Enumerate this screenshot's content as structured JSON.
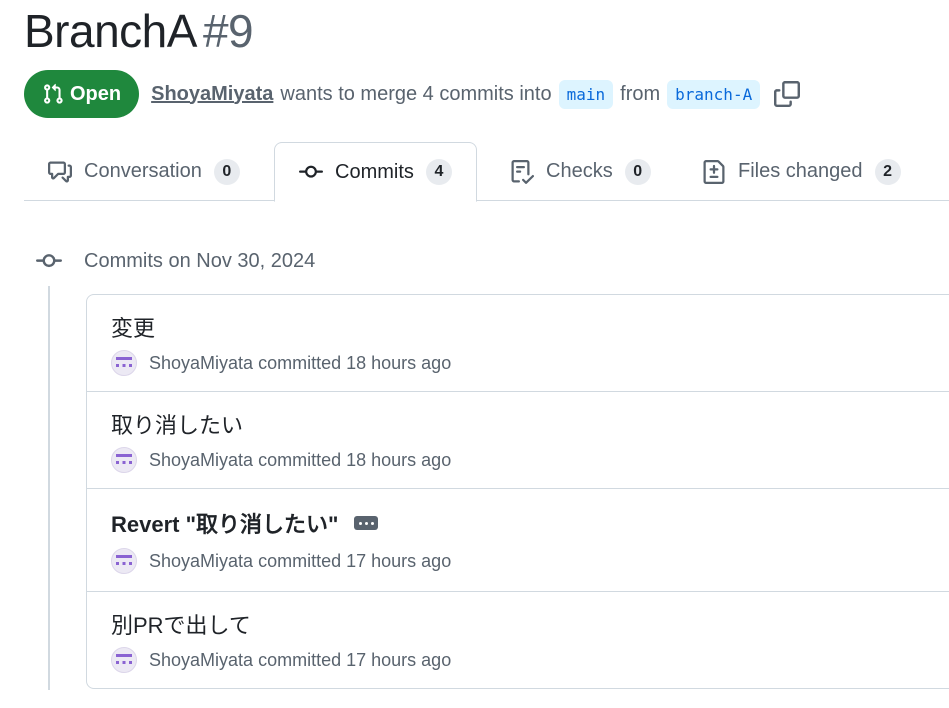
{
  "pr": {
    "title": "BranchA",
    "number": "#9",
    "state": "Open",
    "author": "ShoyaMiyata",
    "merge_text": "wants to merge 4 commits into",
    "base_branch": "main",
    "from_text": "from",
    "head_branch": "branch-A"
  },
  "tabs": [
    {
      "label": "Conversation",
      "count": "0",
      "icon": "comment-discussion-icon"
    },
    {
      "label": "Commits",
      "count": "4",
      "icon": "git-commit-icon"
    },
    {
      "label": "Checks",
      "count": "0",
      "icon": "checklist-icon"
    },
    {
      "label": "Files changed",
      "count": "2",
      "icon": "file-diff-icon"
    }
  ],
  "timeline": {
    "date_label": "Commits on Nov 30, 2024",
    "commits": [
      {
        "message": "変更",
        "author": "ShoyaMiyata",
        "action": "committed",
        "time": "18 hours ago"
      },
      {
        "message": "取り消したい",
        "author": "ShoyaMiyata",
        "action": "committed",
        "time": "18 hours ago"
      },
      {
        "message": "Revert \"取り消したい\"",
        "author": "ShoyaMiyata",
        "action": "committed",
        "time": "17 hours ago"
      },
      {
        "message": "別PRで出して",
        "author": "ShoyaMiyata",
        "action": "committed",
        "time": "17 hours ago"
      }
    ]
  },
  "colors": {
    "open_green": "#1f883d",
    "branch_blue": "#0969da",
    "branch_bg": "#ddf4ff",
    "muted": "#59636e",
    "avatar_purple": "#8a63d2"
  }
}
